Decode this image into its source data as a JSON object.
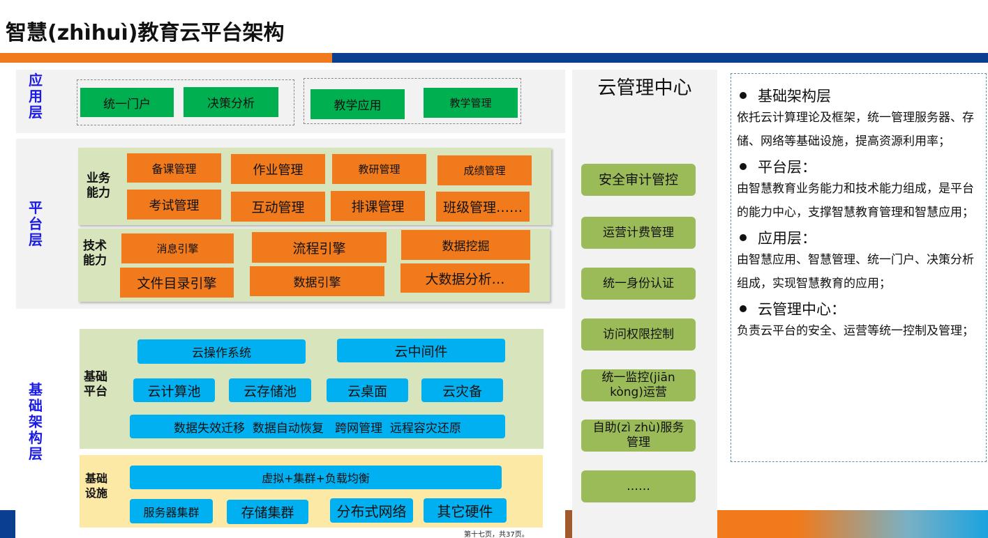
{
  "title": "智慧(zhìhuì)教育云平台架构",
  "colors": {
    "accent_orange": "#f07a1c",
    "accent_navy": "#0a3e8e",
    "layer_label_blue": "#1a1ae6",
    "app_green": "#00b050",
    "capability_orange": "#f07a1c",
    "infra_blue": "#00b0f0",
    "mgmt_green": "#9bbb59",
    "platform_bg": "#d8e4bc",
    "facility_bg": "#fde9a6"
  },
  "app_layer": {
    "label": "应\n用\n层",
    "group1": [
      "统一门户",
      "决策分析"
    ],
    "group2": [
      "教学应用",
      "教学管理"
    ]
  },
  "platform_layer": {
    "label": "平\n台\n层",
    "business": {
      "label": "业务\n能力",
      "items": [
        "备课管理",
        "作业管理",
        "教研管理",
        "成绩管理",
        "考试管理",
        "互动管理",
        "排课管理",
        "班级管理……"
      ]
    },
    "technical": {
      "label": "技术\n能力",
      "items": [
        "消息引擎",
        "流程引擎",
        "数据挖掘",
        "文件目录引擎",
        "数据引擎",
        "大数据分析…"
      ]
    }
  },
  "infra_layer": {
    "label": "基\n础\n架\n构\n层",
    "base_platform": {
      "label": "基础\n平台",
      "items": [
        "云操作系统",
        "云中间件",
        "云计算池",
        "云存储池",
        "云桌面",
        "云灾备",
        "数据失效迁移  数据自动恢复   跨网管理  远程容灾还原"
      ]
    },
    "base_facility": {
      "label": "基础\n设施",
      "items": [
        "虚拟+集群+负载均衡",
        "服务器集群",
        "存储集群",
        "分布式网络",
        "其它硬件"
      ]
    }
  },
  "cloud_mgmt": {
    "title": "云管理中心",
    "items": [
      "安全审计管控",
      "运营计费管理",
      "统一身份认证",
      "访问权限控制",
      "统一监控(jiān kòng)运营",
      "自助(zì zhù)服务管理",
      "……"
    ]
  },
  "description": [
    {
      "heading": "基础架构层",
      "text": "依托云计算理论及框架，统一管理服务器、存储、网络等基础设施，提高资源利用率；"
    },
    {
      "heading": "平台层：",
      "text": "由智慧教育业务能力和技术能力组成，是平台的能力中心，支撑智慧教育管理和智慧应用；"
    },
    {
      "heading": "应用层：",
      "text": "由智慧应用、智慧管理、统一门户、决策分析组成，实现智慧教育的应用；"
    },
    {
      "heading": "云管理中心：",
      "text": "负责云平台的安全、运营等统一控制及管理；"
    }
  ],
  "page_number": "第十七页，共37页。"
}
